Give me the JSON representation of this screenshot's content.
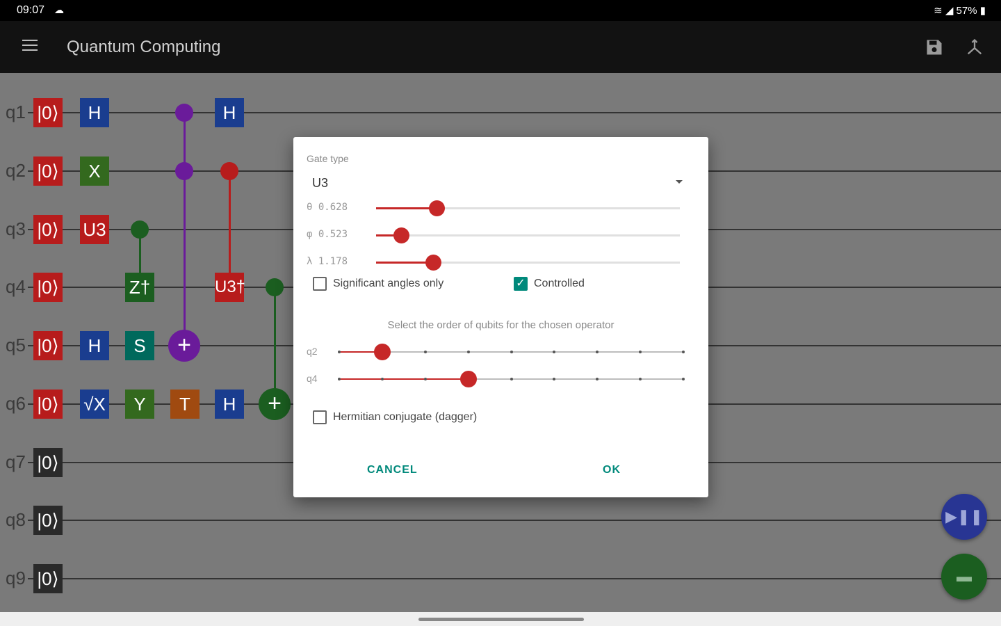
{
  "status": {
    "time": "09:07",
    "battery": "57%"
  },
  "app": {
    "title": "Quantum Computing"
  },
  "circuit": {
    "ket_label": "|0⟩",
    "qubits": [
      {
        "label": "q1",
        "active": true
      },
      {
        "label": "q2",
        "active": true
      },
      {
        "label": "q3",
        "active": true
      },
      {
        "label": "q4",
        "active": true
      },
      {
        "label": "q5",
        "active": true
      },
      {
        "label": "q6",
        "active": true
      },
      {
        "label": "q7",
        "active": false
      },
      {
        "label": "q8",
        "active": false
      },
      {
        "label": "q9",
        "active": false
      }
    ],
    "gates": {
      "q1_h1": "H",
      "q1_h2": "H",
      "q2_x": "X",
      "q3_u3": "U3",
      "q4_z": "Z†",
      "q4_u3": "U3†",
      "q5_h": "H",
      "q5_s": "S",
      "q6_sx": "√X",
      "q6_y": "Y",
      "q6_t": "T",
      "q6_h": "H",
      "target": "+"
    }
  },
  "dialog": {
    "gate_type_caption": "Gate type",
    "gate_type_value": "U3",
    "angles": [
      {
        "label": "θ 0.628",
        "fraction": 0.2
      },
      {
        "label": "φ 0.523",
        "fraction": 0.083
      },
      {
        "label": "λ 1.178",
        "fraction": 0.188
      }
    ],
    "significant_label": "Significant angles only",
    "significant_checked": false,
    "controlled_label": "Controlled",
    "controlled_checked": true,
    "order_title": "Select the order of qubits for the chosen operator",
    "order": [
      {
        "label": "q2",
        "index": 1,
        "steps": 9
      },
      {
        "label": "q4",
        "index": 3,
        "steps": 9
      }
    ],
    "dagger_label": "Hermitian conjugate (dagger)",
    "dagger_checked": false,
    "cancel_label": "CANCEL",
    "ok_label": "OK"
  },
  "colors": {
    "accent": "#00897b",
    "slider": "#c62828",
    "purple": "#6a1b9a",
    "green": "#1b5e20"
  }
}
